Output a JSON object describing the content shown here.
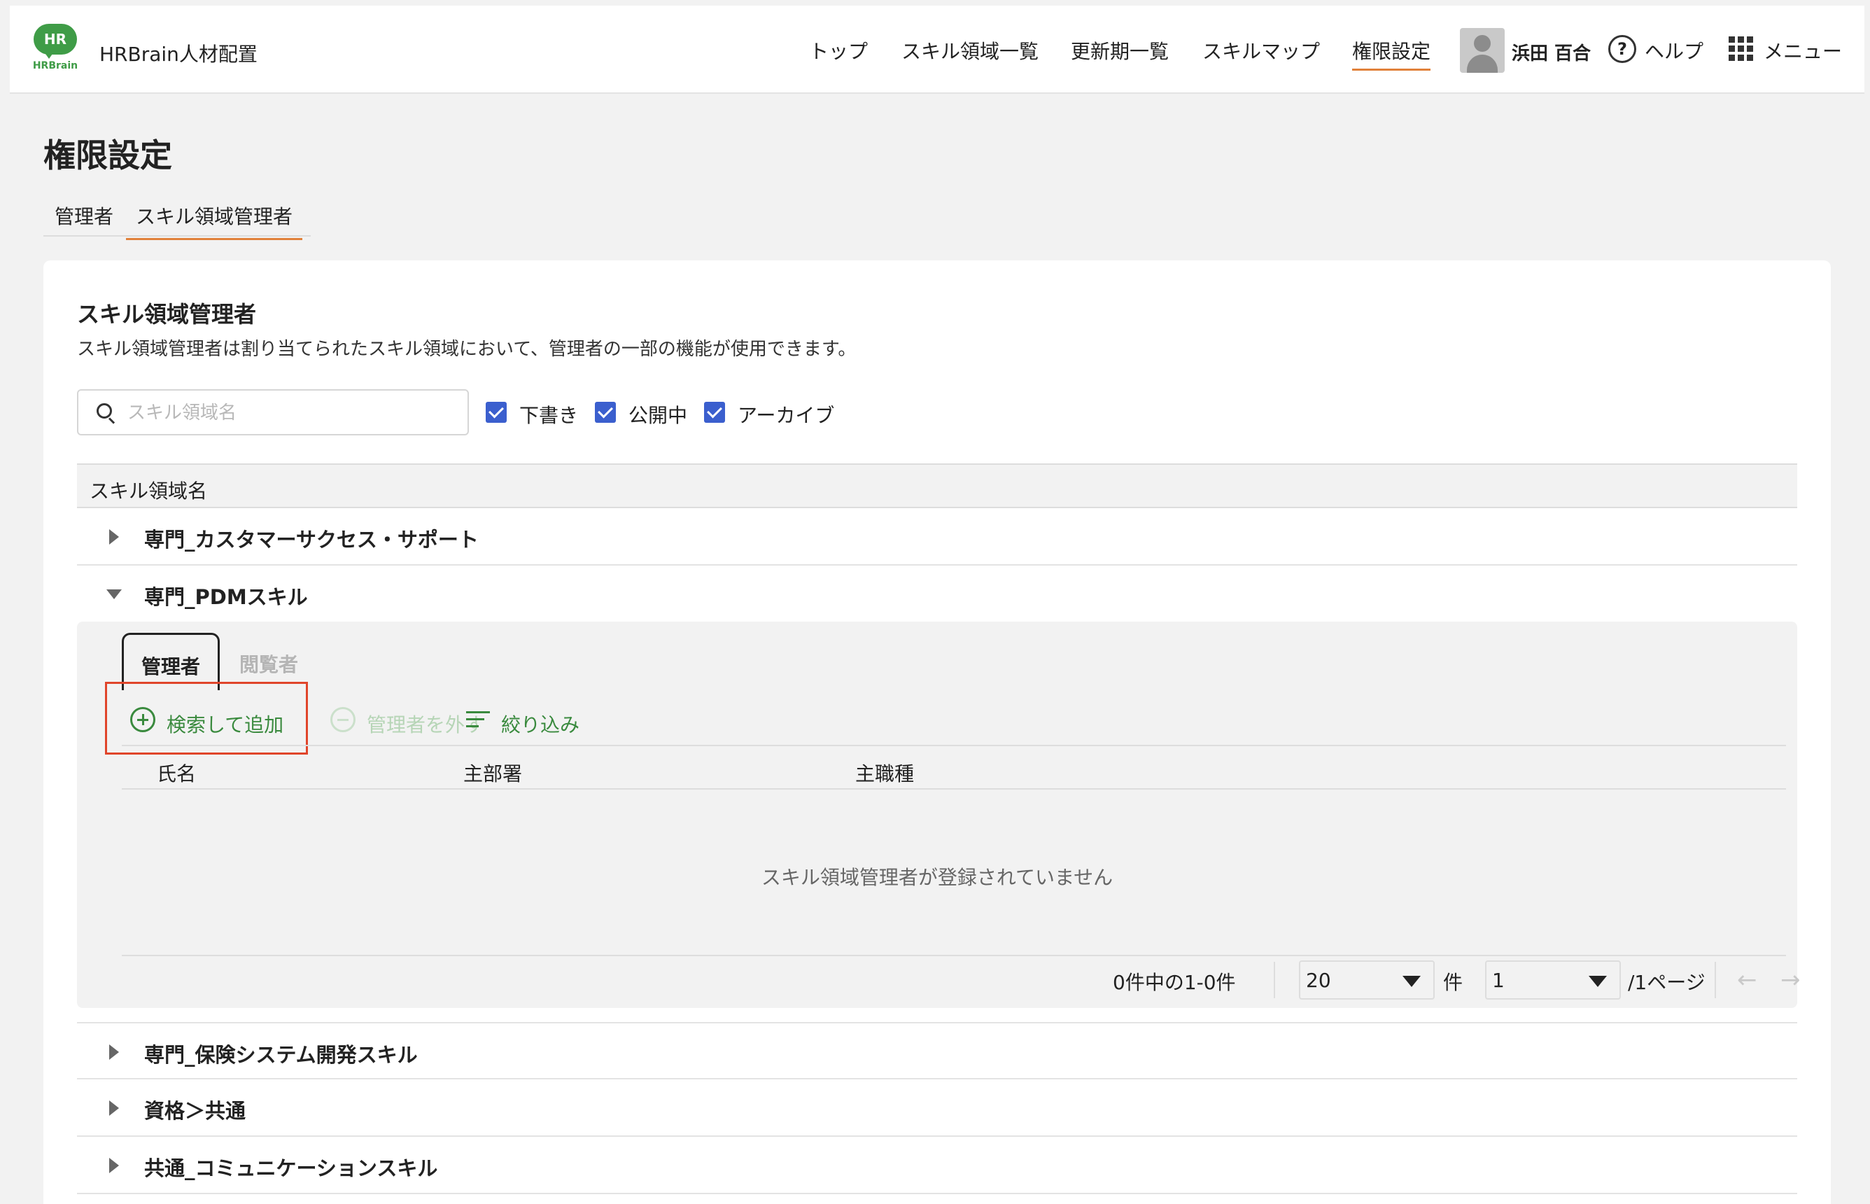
{
  "header": {
    "logo_badge": "HR",
    "logo_text": "HRBrain",
    "app_name": "HRBrain人材配置",
    "nav": [
      "トップ",
      "スキル領域一覧",
      "更新期一覧",
      "スキルマップ",
      "権限設定"
    ],
    "user_name": "浜田 百合",
    "help_label": "ヘルプ",
    "menu_label": "メニュー"
  },
  "page": {
    "title": "権限設定",
    "tabs": [
      "管理者",
      "スキル領域管理者"
    ]
  },
  "section": {
    "title": "スキル領域管理者",
    "description": "スキル領域管理者は割り当てられたスキル領域において、管理者の一部の機能が使用できます。",
    "search_placeholder": "スキル領域名",
    "filters": [
      "下書き",
      "公開中",
      "アーカイブ"
    ],
    "column_header": "スキル領域名"
  },
  "rows": [
    "専門_カスタマーサクセス・サポート",
    "専門_PDMスキル",
    "専門_保険システム開発スキル",
    "資格＞共通",
    "共通_コミュニケーションスキル"
  ],
  "expanded": {
    "tabs": [
      "管理者",
      "閲覧者"
    ],
    "actions": [
      "検索して追加",
      "管理者を外す",
      "絞り込み"
    ],
    "columns": [
      "氏名",
      "主部署",
      "主職種"
    ],
    "empty_message": "スキル領域管理者が登録されていません",
    "pager": {
      "count": "0件中の1-0件",
      "page_size": "20",
      "unit": "件",
      "page": "1",
      "pages": "/1ページ",
      "prev": "←",
      "next": "→"
    }
  },
  "colors": {
    "accent": "#e1813a",
    "brand_green": "#3f9c47",
    "checkbox": "#3b5fce",
    "action_green": "#3a8a3e",
    "highlight": "#e0452b"
  }
}
